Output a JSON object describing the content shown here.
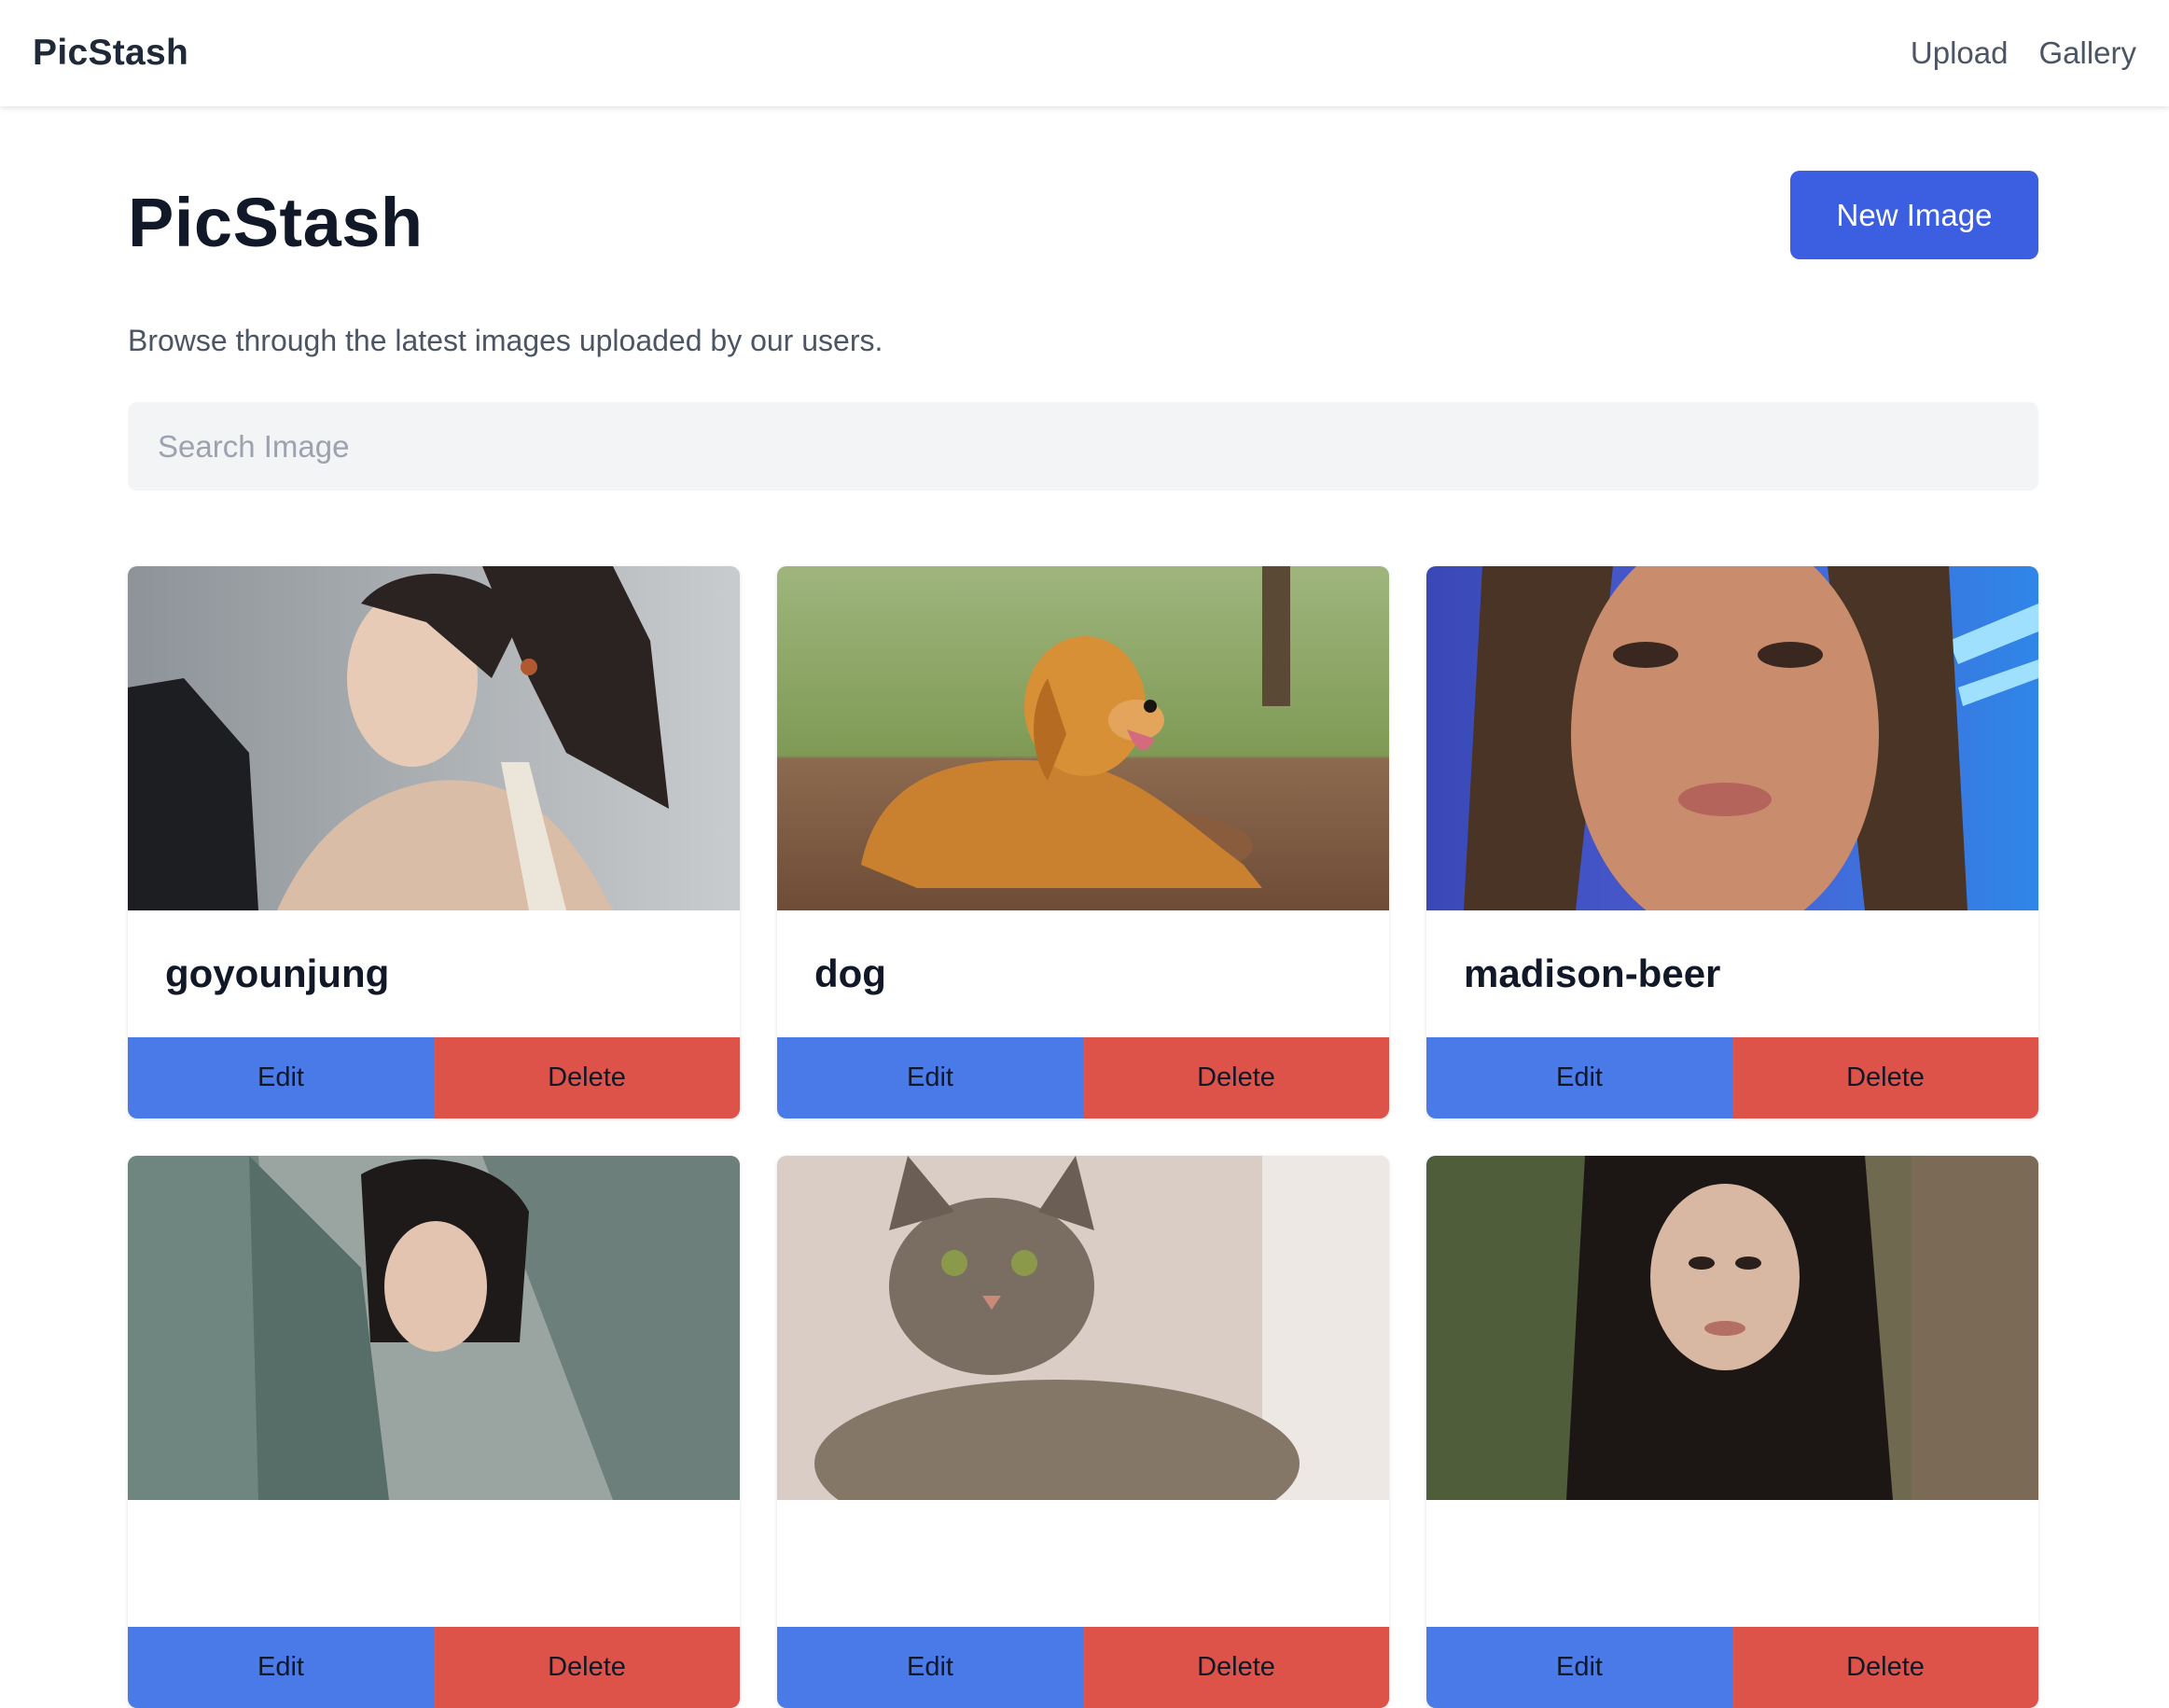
{
  "navbar": {
    "brand": "PicStash",
    "links": [
      "Upload",
      "Gallery"
    ]
  },
  "header": {
    "title": "PicStash",
    "new_button": "New Image",
    "subtitle": "Browse through the latest images uploaded by our users."
  },
  "search": {
    "placeholder": "Search Image",
    "value": ""
  },
  "actions": {
    "edit_label": "Edit",
    "delete_label": "Delete"
  },
  "cards": [
    {
      "title": "goyounjung"
    },
    {
      "title": "dog"
    },
    {
      "title": "madison-beer"
    },
    {
      "title": ""
    },
    {
      "title": ""
    },
    {
      "title": ""
    }
  ],
  "colors": {
    "primary": "#3b5fe0",
    "edit": "#4a7ae8",
    "delete": "#de5349",
    "search_bg": "#f3f4f6"
  }
}
